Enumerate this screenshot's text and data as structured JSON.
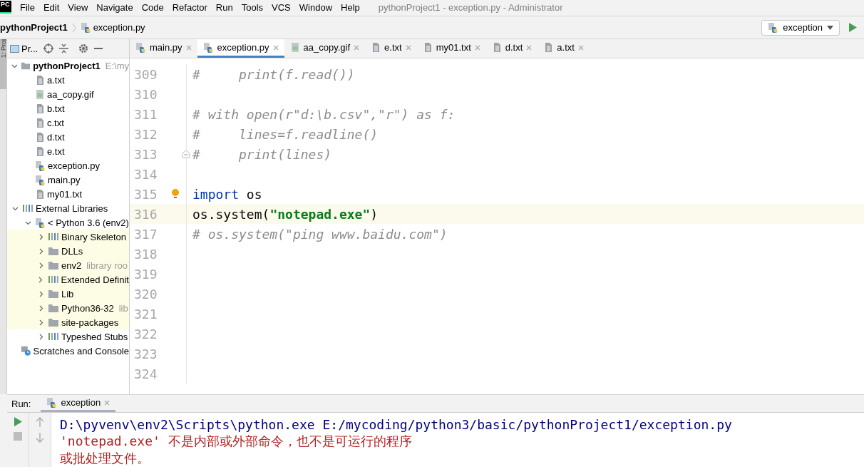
{
  "menu": [
    {
      "label": "File"
    },
    {
      "label": "Edit"
    },
    {
      "label": "View"
    },
    {
      "label": "Navigate"
    },
    {
      "label": "Code"
    },
    {
      "label": "Refactor"
    },
    {
      "label": "Run"
    },
    {
      "label": "Tools"
    },
    {
      "label": "VCS"
    },
    {
      "label": "Window"
    },
    {
      "label": "Help"
    }
  ],
  "window": {
    "title": "pythonProject1 - exception.py - Administrator",
    "logo": "PC"
  },
  "breadcrumbs": [
    {
      "label": "pythonProject1",
      "kind": "project"
    },
    {
      "label": "exception.py",
      "kind": "python"
    }
  ],
  "run_config": {
    "label": "exception"
  },
  "project_panel": {
    "title": "Pr...",
    "side_tab": "1: Proj"
  },
  "tabs": [
    {
      "label": "main.py",
      "kind": "python",
      "selected": false
    },
    {
      "label": "exception.py",
      "kind": "python",
      "selected": true
    },
    {
      "label": "aa_copy.gif",
      "kind": "image",
      "selected": false
    },
    {
      "label": "e.txt",
      "kind": "text",
      "selected": false
    },
    {
      "label": "my01.txt",
      "kind": "text",
      "selected": false
    },
    {
      "label": "d.txt",
      "kind": "text",
      "selected": false
    },
    {
      "label": "a.txt",
      "kind": "text",
      "selected": false
    }
  ],
  "tree": [
    {
      "label": "pythonProject1",
      "hint": "E:\\my",
      "kind": "folder",
      "expanded": true,
      "children": [
        {
          "label": "a.txt",
          "kind": "text"
        },
        {
          "label": "aa_copy.gif",
          "kind": "image"
        },
        {
          "label": "b.txt",
          "kind": "text"
        },
        {
          "label": "c.txt",
          "kind": "text"
        },
        {
          "label": "d.txt",
          "kind": "text"
        },
        {
          "label": "e.txt",
          "kind": "text"
        },
        {
          "label": "exception.py",
          "kind": "python"
        },
        {
          "label": "main.py",
          "kind": "python"
        },
        {
          "label": "my01.txt",
          "kind": "text"
        }
      ]
    },
    {
      "label": "External Libraries",
      "kind": "library",
      "expanded": true,
      "children": [
        {
          "label": "< Python 3.6 (env2)",
          "kind": "python",
          "expanded": true,
          "children": [
            {
              "label": "Binary Skeleton",
              "kind": "library",
              "expanded": false,
              "highlighted": true
            },
            {
              "label": "DLLs",
              "kind": "folder",
              "expanded": false,
              "highlighted": true
            },
            {
              "label": "env2",
              "hint": "library roo",
              "kind": "folder",
              "expanded": false,
              "highlighted": true
            },
            {
              "label": "Extended Definit",
              "kind": "library",
              "expanded": false,
              "highlighted": true
            },
            {
              "label": "Lib",
              "kind": "folder",
              "expanded": false,
              "highlighted": true
            },
            {
              "label": "Python36-32",
              "hint": "lib",
              "kind": "folder",
              "expanded": false,
              "highlighted": true
            },
            {
              "label": "site-packages",
              "kind": "folder",
              "expanded": false,
              "highlighted": true
            },
            {
              "label": "Typeshed Stubs",
              "kind": "library",
              "expanded": false,
              "highlighted": false
            }
          ]
        }
      ]
    },
    {
      "label": "Scratches and Console",
      "kind": "scratch"
    }
  ],
  "code_lines": [
    {
      "number": "309",
      "current": false,
      "tokens": [
        {
          "kind": "comment",
          "text": "#     print(f.read())"
        }
      ]
    },
    {
      "number": "310",
      "current": false
    },
    {
      "number": "311",
      "current": false,
      "tokens": [
        {
          "kind": "comment",
          "text": "# with open(r\"d:\\b.csv\",\"r\") as f:"
        }
      ]
    },
    {
      "number": "312",
      "current": false,
      "tokens": [
        {
          "kind": "comment",
          "text": "#     lines=f.readline()"
        }
      ]
    },
    {
      "number": "313",
      "current": false,
      "fold": true,
      "tokens": [
        {
          "kind": "comment",
          "text": "#     print(lines)"
        }
      ]
    },
    {
      "number": "314",
      "current": false
    },
    {
      "number": "315",
      "current": false,
      "bulb": true,
      "tokens": [
        {
          "kind": "keyword",
          "text": "import"
        },
        {
          "kind": "plain",
          "text": " os"
        }
      ]
    },
    {
      "number": "316",
      "current": true,
      "tokens": [
        {
          "kind": "plain",
          "text": "os.system("
        },
        {
          "kind": "string",
          "text": "\"notepad.exe\""
        },
        {
          "kind": "plain",
          "text": ")"
        }
      ]
    },
    {
      "number": "317",
      "current": false,
      "tokens": [
        {
          "kind": "comment",
          "text": "# os.system(\"ping www.baidu.com\")"
        }
      ]
    },
    {
      "number": "318",
      "current": false
    },
    {
      "number": "319",
      "current": false
    },
    {
      "number": "320",
      "current": false
    },
    {
      "number": "321",
      "current": false
    },
    {
      "number": "322",
      "current": false
    },
    {
      "number": "323",
      "current": false
    },
    {
      "number": "324",
      "current": false
    }
  ],
  "run_panel": {
    "label": "Run:",
    "tab": "exception",
    "output": [
      {
        "kind": "command",
        "text": "D:\\pyvenv\\env2\\Scripts\\python.exe E:/mycoding/python3/basic/pythonProject1/exception.py"
      },
      {
        "kind": "error",
        "text": "'notepad.exe' 不是内部或外部命令，也不是可运行的程序"
      },
      {
        "kind": "error",
        "text": "或批处理文件。"
      }
    ]
  }
}
